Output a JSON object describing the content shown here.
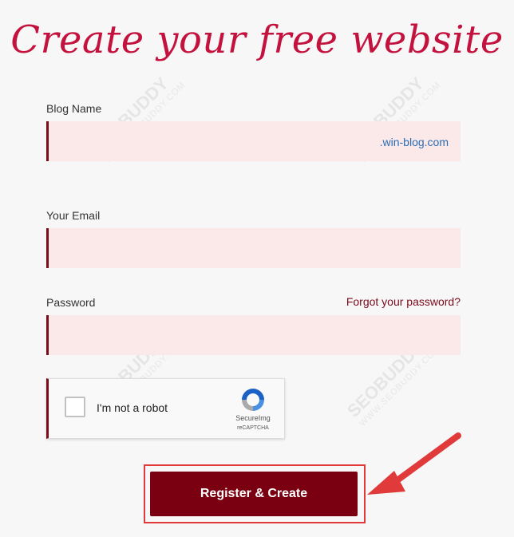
{
  "page": {
    "title": "Create your free website"
  },
  "form": {
    "blog_name_label": "Blog Name",
    "blog_suffix": ".win-blog.com",
    "email_label": "Your Email",
    "password_label": "Password",
    "forgot_password": "Forgot your password?",
    "captcha_label": "I'm not a robot",
    "captcha_brand": "SecureImg",
    "captcha_sub": "reCAPTCHA",
    "submit_label": "Register & Create"
  },
  "watermark": {
    "brand": "SEOBUDDY",
    "domain": "WWW.SEOBUDDY.COM"
  },
  "colors": {
    "title": "#c4123e",
    "accent": "#7a0b1a",
    "field_bg": "#fbe8e8",
    "button": "#7a0011",
    "highlight": "#e03a3a",
    "link": "#2a6db5"
  }
}
